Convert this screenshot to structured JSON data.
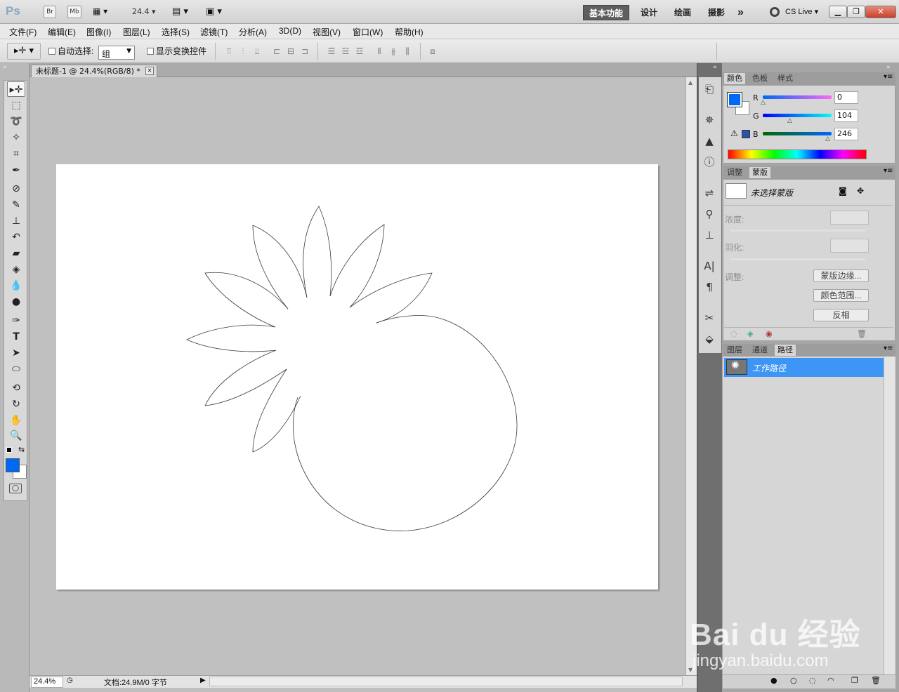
{
  "app": {
    "logo": "Ps",
    "bridge": "Br",
    "minibridge": "Mb",
    "zoom_value": "24.4",
    "workspaces": [
      "基本功能",
      "设计",
      "绘画",
      "摄影"
    ],
    "more": "»",
    "cslive": "CS Live"
  },
  "menu": [
    "文件(F)",
    "编辑(E)",
    "图像(I)",
    "图层(L)",
    "选择(S)",
    "滤镜(T)",
    "分析(A)",
    "3D(D)",
    "视图(V)",
    "窗口(W)",
    "帮助(H)"
  ],
  "options": {
    "auto_select_label": "自动选择:",
    "auto_select_value": "组",
    "show_transform_label": "显示变换控件"
  },
  "document": {
    "tab_title": "未标题-1 @ 24.4%(RGB/8) *",
    "close": "×"
  },
  "status": {
    "zoom": "24.4%",
    "doc_info": "文档:24.9M/0 字节"
  },
  "color_panel": {
    "tabs": [
      "颜色",
      "色板",
      "样式"
    ],
    "r_label": "R",
    "g_label": "G",
    "b_label": "B",
    "r": "0",
    "g": "104",
    "b": "246",
    "foreground": "#0068f6",
    "background": "#ffffff"
  },
  "mask_panel": {
    "tabs": [
      "调整",
      "蒙版"
    ],
    "title": "未选择蒙版",
    "density_label": "浓度:",
    "feather_label": "羽化:",
    "refine_label": "调整:",
    "btn_edge": "蒙版边缘...",
    "btn_range": "颜色范围...",
    "btn_invert": "反相"
  },
  "paths_panel": {
    "tabs": [
      "图层",
      "通道",
      "路径"
    ],
    "items": [
      {
        "name": "工作路径"
      }
    ]
  },
  "watermark": {
    "logo": "Bai du 经验",
    "url": "jingyan.baidu.com"
  }
}
